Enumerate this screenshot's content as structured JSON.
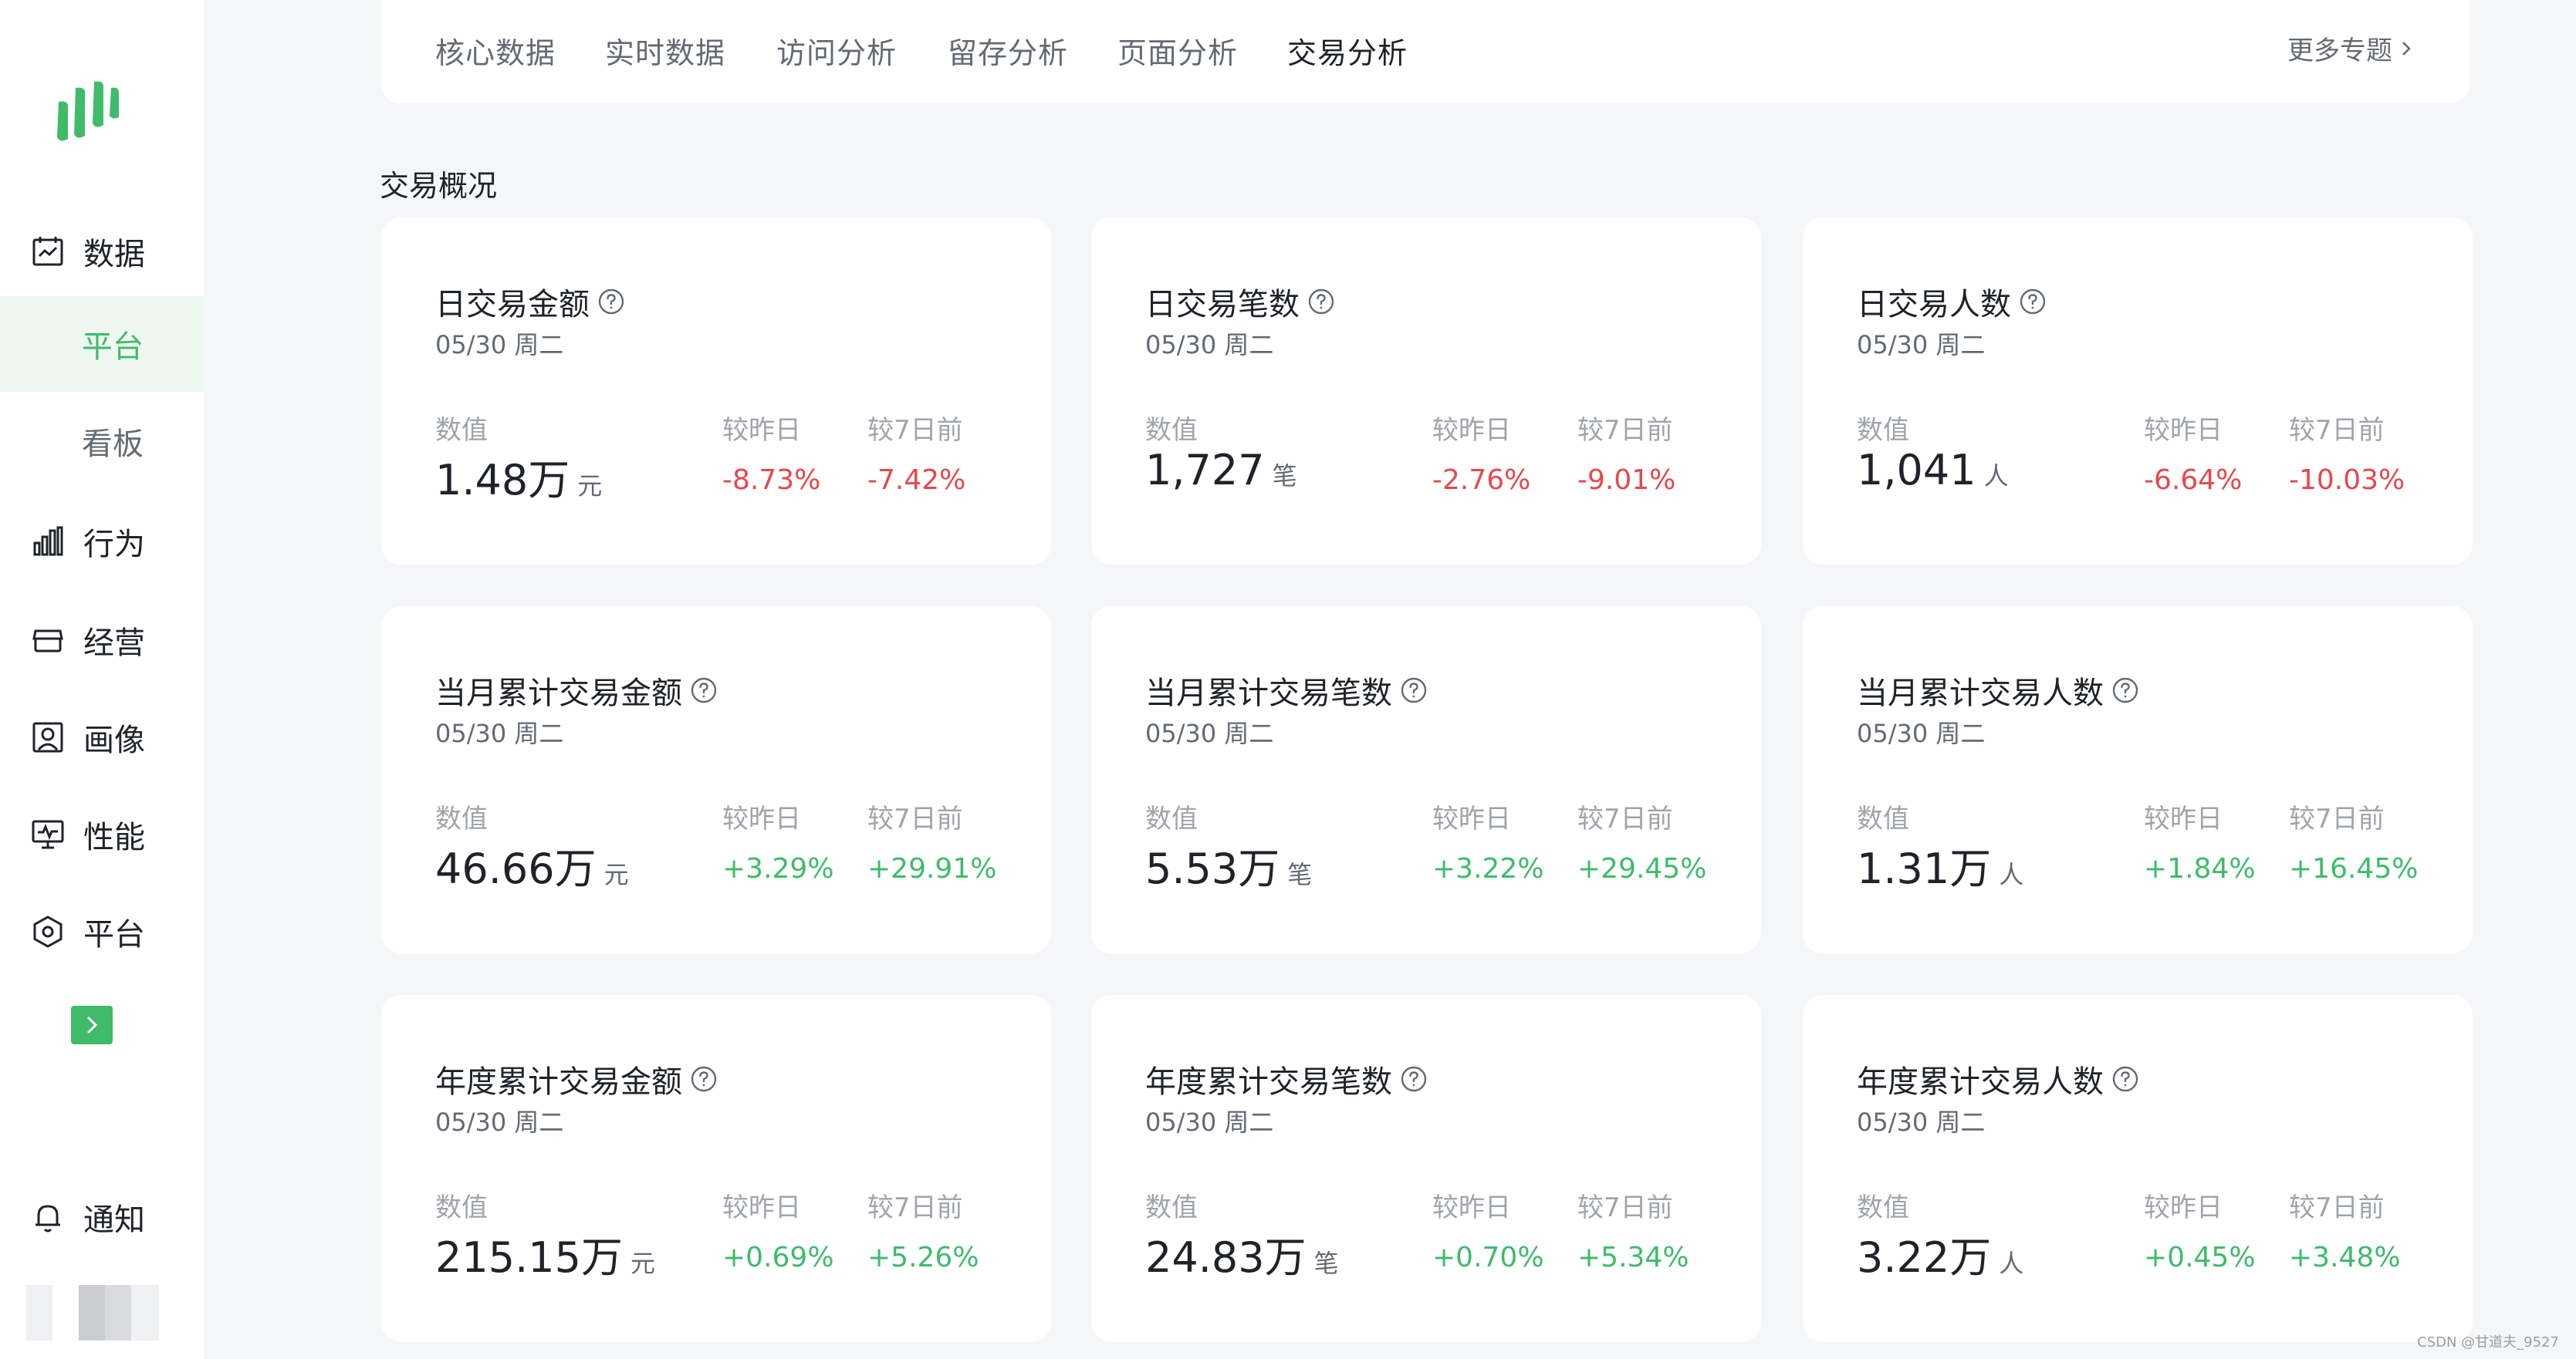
{
  "sidebar": {
    "items": [
      {
        "label": "数据",
        "icon": "calendar-chart-icon"
      },
      {
        "label": "平台",
        "sub": true,
        "active": true
      },
      {
        "label": "看板",
        "sub": true
      },
      {
        "label": "行为",
        "icon": "bar-chart-icon"
      },
      {
        "label": "经营",
        "icon": "store-icon"
      },
      {
        "label": "画像",
        "icon": "portrait-icon"
      },
      {
        "label": "性能",
        "icon": "monitor-icon"
      },
      {
        "label": "平台",
        "icon": "hexagon-icon"
      }
    ],
    "notify": "通知"
  },
  "tabs": [
    "核心数据",
    "实时数据",
    "访问分析",
    "留存分析",
    "页面分析",
    "交易分析"
  ],
  "active_tab": "交易分析",
  "more": "更多专题",
  "section_title": "交易概况",
  "labels": {
    "value": "数值",
    "vs_yesterday": "较昨日",
    "vs_7days": "较7日前"
  },
  "cards": [
    {
      "title": "日交易金额",
      "date": "05/30 周二",
      "value": "1.48万",
      "unit": "元",
      "d1": "-8.73%",
      "d7": "-7.42%"
    },
    {
      "title": "日交易笔数",
      "date": "05/30 周二",
      "value": "1,727",
      "unit": "笔",
      "d1": "-2.76%",
      "d7": "-9.01%"
    },
    {
      "title": "日交易人数",
      "date": "05/30 周二",
      "value": "1,041",
      "unit": "人",
      "d1": "-6.64%",
      "d7": "-10.03%"
    },
    {
      "title": "当月累计交易金额",
      "date": "05/30 周二",
      "value": "46.66万",
      "unit": "元",
      "d1": "+3.29%",
      "d7": "+29.91%"
    },
    {
      "title": "当月累计交易笔数",
      "date": "05/30 周二",
      "value": "5.53万",
      "unit": "笔",
      "d1": "+3.22%",
      "d7": "+29.45%"
    },
    {
      "title": "当月累计交易人数",
      "date": "05/30 周二",
      "value": "1.31万",
      "unit": "人",
      "d1": "+1.84%",
      "d7": "+16.45%"
    },
    {
      "title": "年度累计交易金额",
      "date": "05/30 周二",
      "value": "215.15万",
      "unit": "元",
      "d1": "+0.69%",
      "d7": "+5.26%"
    },
    {
      "title": "年度累计交易笔数",
      "date": "05/30 周二",
      "value": "24.83万",
      "unit": "笔",
      "d1": "+0.70%",
      "d7": "+5.34%"
    },
    {
      "title": "年度累计交易人数",
      "date": "05/30 周二",
      "value": "3.22万",
      "unit": "人",
      "d1": "+0.45%",
      "d7": "+3.48%"
    }
  ],
  "colors": {
    "accent": "#3fbb6a",
    "negative": "#e5484d",
    "positive": "#3fbb6a"
  },
  "watermark": "CSDN @甘道夫_9527"
}
